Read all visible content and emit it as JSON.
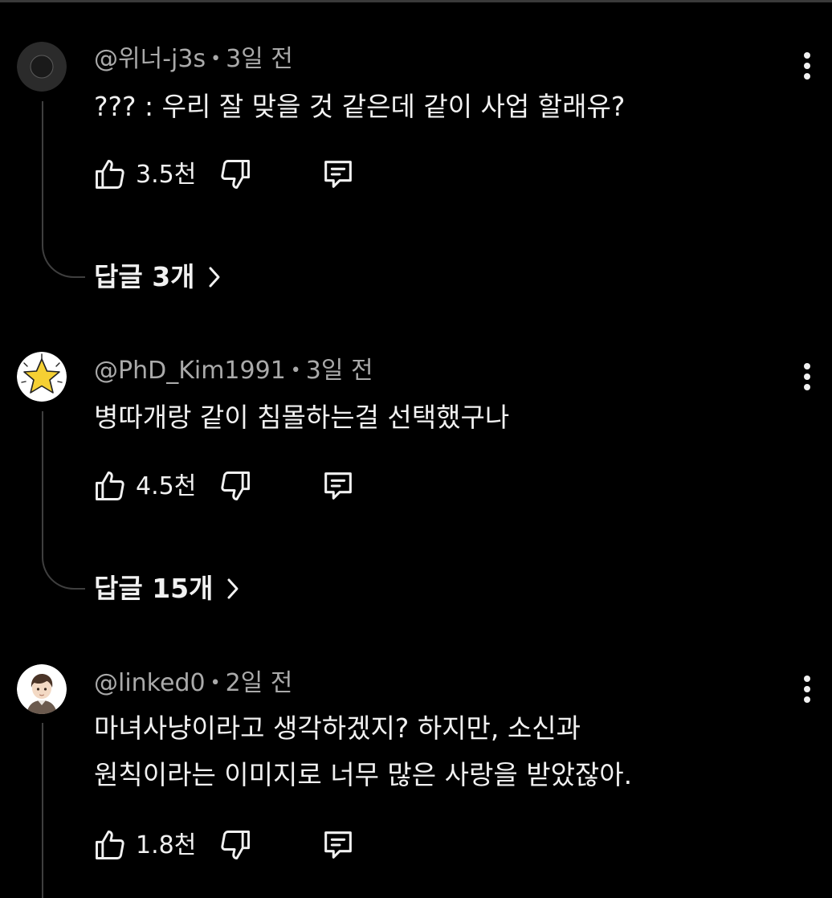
{
  "comments": [
    {
      "handle": "@위너-j3s",
      "separator": "•",
      "time": "3일 전",
      "text_lines": [
        "??? : 우리 잘 맞을 것 같은데 같이 사업 할래유?"
      ],
      "likes": "3.5천",
      "replies_label": "답글 3개",
      "avatar_icon": "dark-circle-avatar"
    },
    {
      "handle": "@PhD_Kim1991",
      "separator": "•",
      "time": "3일 전",
      "text_lines": [
        "병따개랑 같이 침몰하는걸 선택했구나"
      ],
      "likes": "4.5천",
      "replies_label": "답글 15개",
      "avatar_icon": "yellow-star-avatar"
    },
    {
      "handle": "@linked0",
      "separator": "•",
      "time": "2일 전",
      "text_lines": [
        "마녀사냥이라고 생각하겠지? 하지만, 소신과",
        "원칙이라는 이미지로 너무 많은 사랑을 받았잖아."
      ],
      "likes": "1.8천",
      "avatar_icon": "cartoon-man-avatar"
    }
  ],
  "icons": {
    "like": "thumbs-up-icon",
    "dislike": "thumbs-down-icon",
    "reply": "comment-icon",
    "menu": "more-vertical-icon",
    "replies_chevron": "chevron-right-icon"
  },
  "colors": {
    "background": "#000000",
    "text": "#f1f1f1",
    "meta": "#aaaaaa",
    "thread_line": "#3f3f3f",
    "star": "#f5d033"
  }
}
